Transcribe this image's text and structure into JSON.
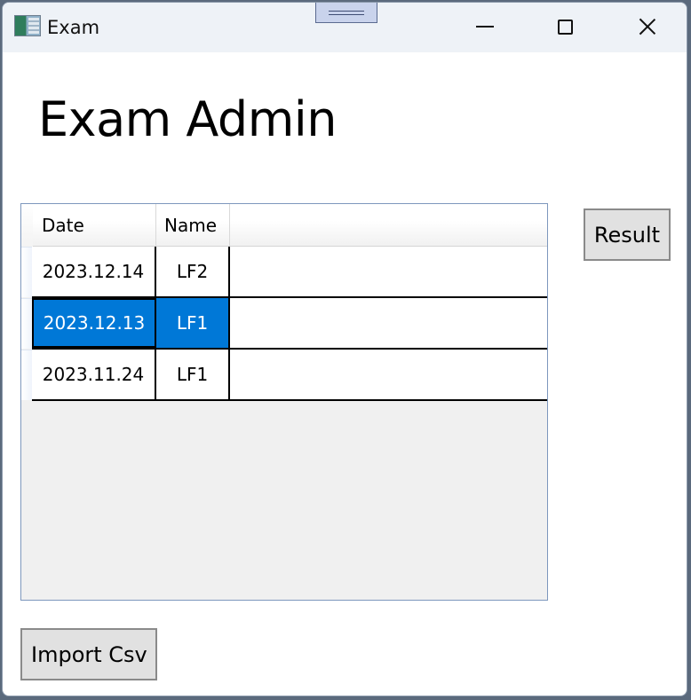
{
  "window": {
    "title": "Exam",
    "controls": [
      "minimize-icon",
      "maximize-icon",
      "close-icon"
    ]
  },
  "page": {
    "heading": "Exam Admin"
  },
  "grid": {
    "columns": [
      "Date",
      "Name"
    ],
    "rows": [
      {
        "date": "2023.12.14",
        "name": "LF2",
        "selected": false
      },
      {
        "date": "2023.12.13",
        "name": "LF1",
        "selected": true
      },
      {
        "date": "2023.11.24",
        "name": "LF1",
        "selected": false
      }
    ]
  },
  "buttons": {
    "result": "Result",
    "import_csv": "Import Csv"
  },
  "colors": {
    "selection": "#0078d7",
    "title_bar": "#eef2f7",
    "grid_border": "#7d97bd"
  }
}
